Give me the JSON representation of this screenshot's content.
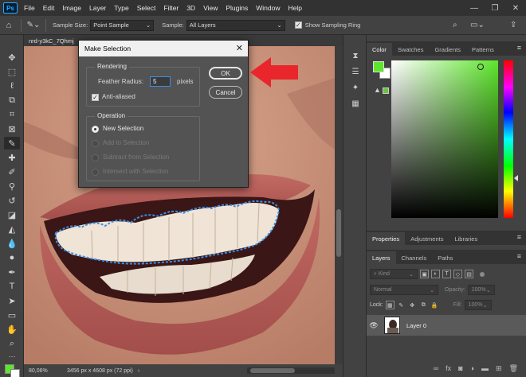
{
  "menubar": {
    "logo": "Ps",
    "items": [
      "File",
      "Edit",
      "Image",
      "Layer",
      "Type",
      "Select",
      "Filter",
      "3D",
      "View",
      "Plugins",
      "Window",
      "Help"
    ]
  },
  "options": {
    "sample_size_label": "Sample Size:",
    "sample_size_value": "Point Sample",
    "sample_label": "Sample:",
    "sample_value": "All Layers",
    "show_ring_label": "Show Sampling Ring"
  },
  "document": {
    "tab_title": "nrd-y3kC_7Qhmj",
    "zoom": "80,06%",
    "info": "3456 px x 4608 px (72 ppi)"
  },
  "dialog": {
    "title": "Make Selection",
    "rendering_title": "Rendering",
    "feather_label": "Feather Radius:",
    "feather_value": "5",
    "feather_unit": "pixels",
    "antialias_label": "Anti-aliased",
    "operation_title": "Operation",
    "options": [
      {
        "label": "New Selection",
        "enabled": true,
        "selected": true
      },
      {
        "label": "Add to Selection",
        "enabled": false,
        "selected": false
      },
      {
        "label": "Subtract from Selection",
        "enabled": false,
        "selected": false
      },
      {
        "label": "Intersect with Selection",
        "enabled": false,
        "selected": false
      }
    ],
    "ok_label": "OK",
    "cancel_label": "Cancel"
  },
  "color_panel": {
    "tabs": [
      "Color",
      "Swatches",
      "Gradients",
      "Patterns"
    ],
    "foreground": "#5ee62c",
    "background": "#ffffff"
  },
  "properties_panel": {
    "tabs": [
      "Properties",
      "Adjustments",
      "Libraries"
    ]
  },
  "layers_panel": {
    "tabs": [
      "Layers",
      "Channels",
      "Paths"
    ],
    "kind_placeholder": "Kind",
    "blend_mode": "Normal",
    "opacity_label": "Opacity:",
    "opacity_value": "100%",
    "lock_label": "Lock:",
    "fill_label": "Fill:",
    "fill_value": "100%",
    "layer_name": "Layer 0"
  },
  "colors": {
    "accent_blue": "#3d8ee0",
    "annotation_red": "#e8262c",
    "selection_path": "#3a8fe8"
  }
}
